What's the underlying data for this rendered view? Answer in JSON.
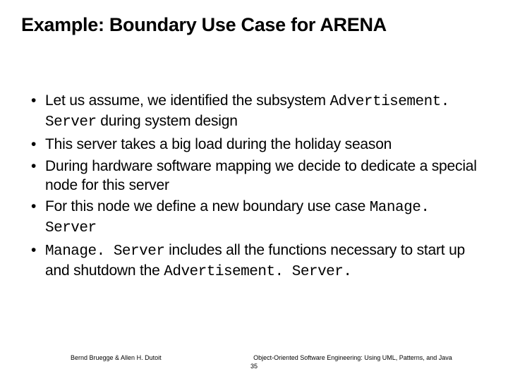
{
  "title": "Example: Boundary Use Case for ARENA",
  "bullets": [
    {
      "pre": "Let us assume, we identified the subsystem ",
      "code": "Advertisement. Server",
      "post": " during system design"
    },
    {
      "pre": "This server takes a big load during the holiday season",
      "code": "",
      "post": ""
    },
    {
      "pre": "During hardware software mapping we decide to dedicate a special node for this server",
      "code": "",
      "post": ""
    },
    {
      "pre": "For this node we define a new boundary use case ",
      "code": "Manage. Server",
      "post": ""
    },
    {
      "pre": "",
      "code": "Manage. Server",
      "post": " includes all the functions necessary to start up and shutdown the ",
      "code2": "Advertisement. Server.",
      "post2": ""
    }
  ],
  "footer": {
    "left": "Bernd Bruegge & Allen H. Dutoit",
    "right": "Object-Oriented Software Engineering: Using UML, Patterns, and Java",
    "page": "35"
  }
}
